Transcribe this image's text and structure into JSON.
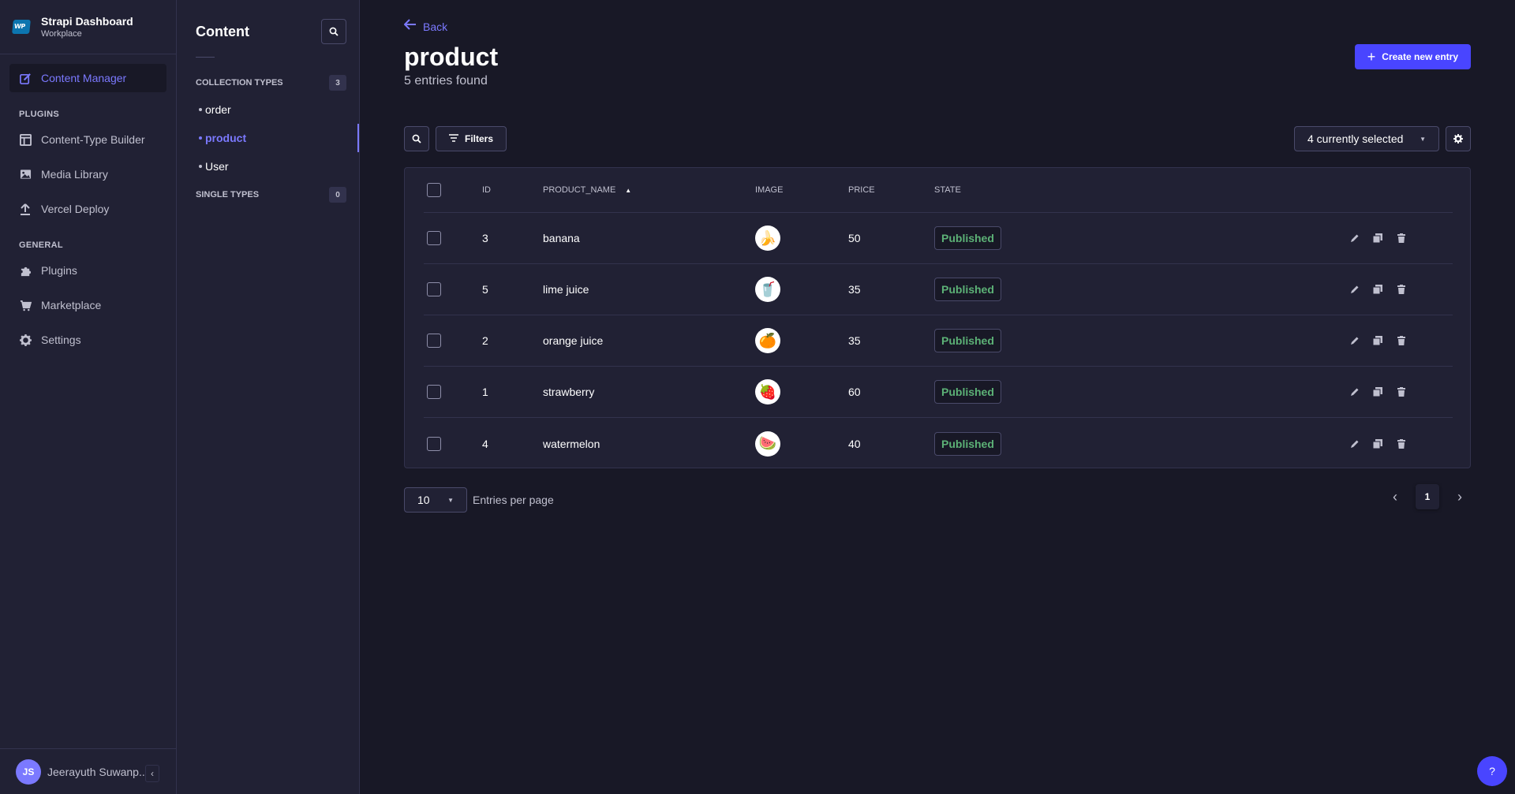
{
  "brand": {
    "title": "Strapi Dashboard",
    "subtitle": "Workplace",
    "logo_text": "WP"
  },
  "nav": {
    "content_manager": "Content Manager",
    "plugins_section": "PLUGINS",
    "content_type_builder": "Content-Type Builder",
    "media_library": "Media Library",
    "vercel_deploy": "Vercel Deploy",
    "general_section": "GENERAL",
    "plugins": "Plugins",
    "marketplace": "Marketplace",
    "settings": "Settings"
  },
  "user": {
    "initials": "JS",
    "name": "Jeerayuth Suwanp..."
  },
  "subnav": {
    "title": "Content",
    "collection_label": "COLLECTION TYPES",
    "collection_count": "3",
    "collection_items": [
      "order",
      "product",
      "User"
    ],
    "single_label": "SINGLE TYPES",
    "single_count": "0"
  },
  "header": {
    "back": "Back",
    "title": "product",
    "subtitle": "5 entries found",
    "create_button": "Create new entry"
  },
  "toolbar": {
    "filters": "Filters",
    "columns_select": "4 currently selected"
  },
  "table": {
    "headers": {
      "id": "ID",
      "product_name": "PRODUCT_NAME",
      "image": "IMAGE",
      "price": "PRICE",
      "state": "STATE"
    },
    "rows": [
      {
        "id": "3",
        "name": "banana",
        "image": "🍌",
        "price": "50",
        "state": "Published"
      },
      {
        "id": "5",
        "name": "lime juice",
        "image": "🥤",
        "price": "35",
        "state": "Published"
      },
      {
        "id": "2",
        "name": "orange juice",
        "image": "🍊",
        "price": "35",
        "state": "Published"
      },
      {
        "id": "1",
        "name": "strawberry",
        "image": "🍓",
        "price": "60",
        "state": "Published"
      },
      {
        "id": "4",
        "name": "watermelon",
        "image": "🍉",
        "price": "40",
        "state": "Published"
      }
    ]
  },
  "pagination": {
    "per_page": "10",
    "per_page_label": "Entries per page",
    "current_page": "1"
  },
  "help": "?",
  "colors": {
    "accent": "#4945ff",
    "accent_text": "#7b79ff",
    "published": "#5cb176",
    "background": "#181826",
    "panel": "#212134"
  }
}
